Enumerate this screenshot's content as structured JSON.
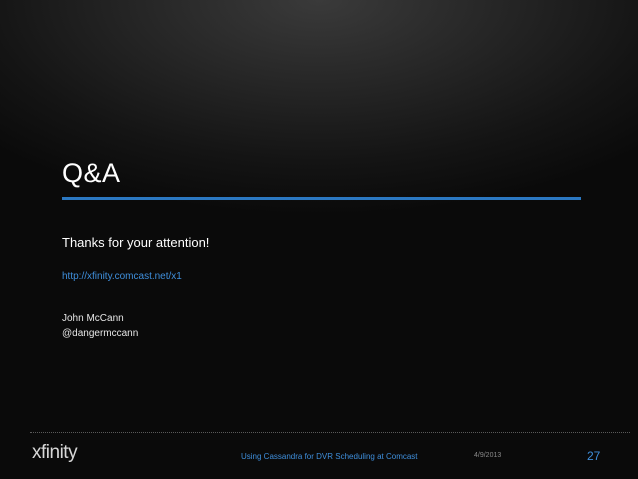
{
  "slide": {
    "title": "Q&A",
    "subtitle": "Thanks for your attention!",
    "link": "http://xfinity.comcast.net/x1",
    "author": {
      "name": "John McCann",
      "handle": "@dangermccann"
    }
  },
  "footer": {
    "logo_text": "xfinity",
    "presentation_title": "Using Cassandra for DVR Scheduling at Comcast",
    "date": "4/9/2013",
    "page_number": "27"
  },
  "colors": {
    "accent_blue": "#2b78c2",
    "link_blue": "#3f8fdc"
  }
}
